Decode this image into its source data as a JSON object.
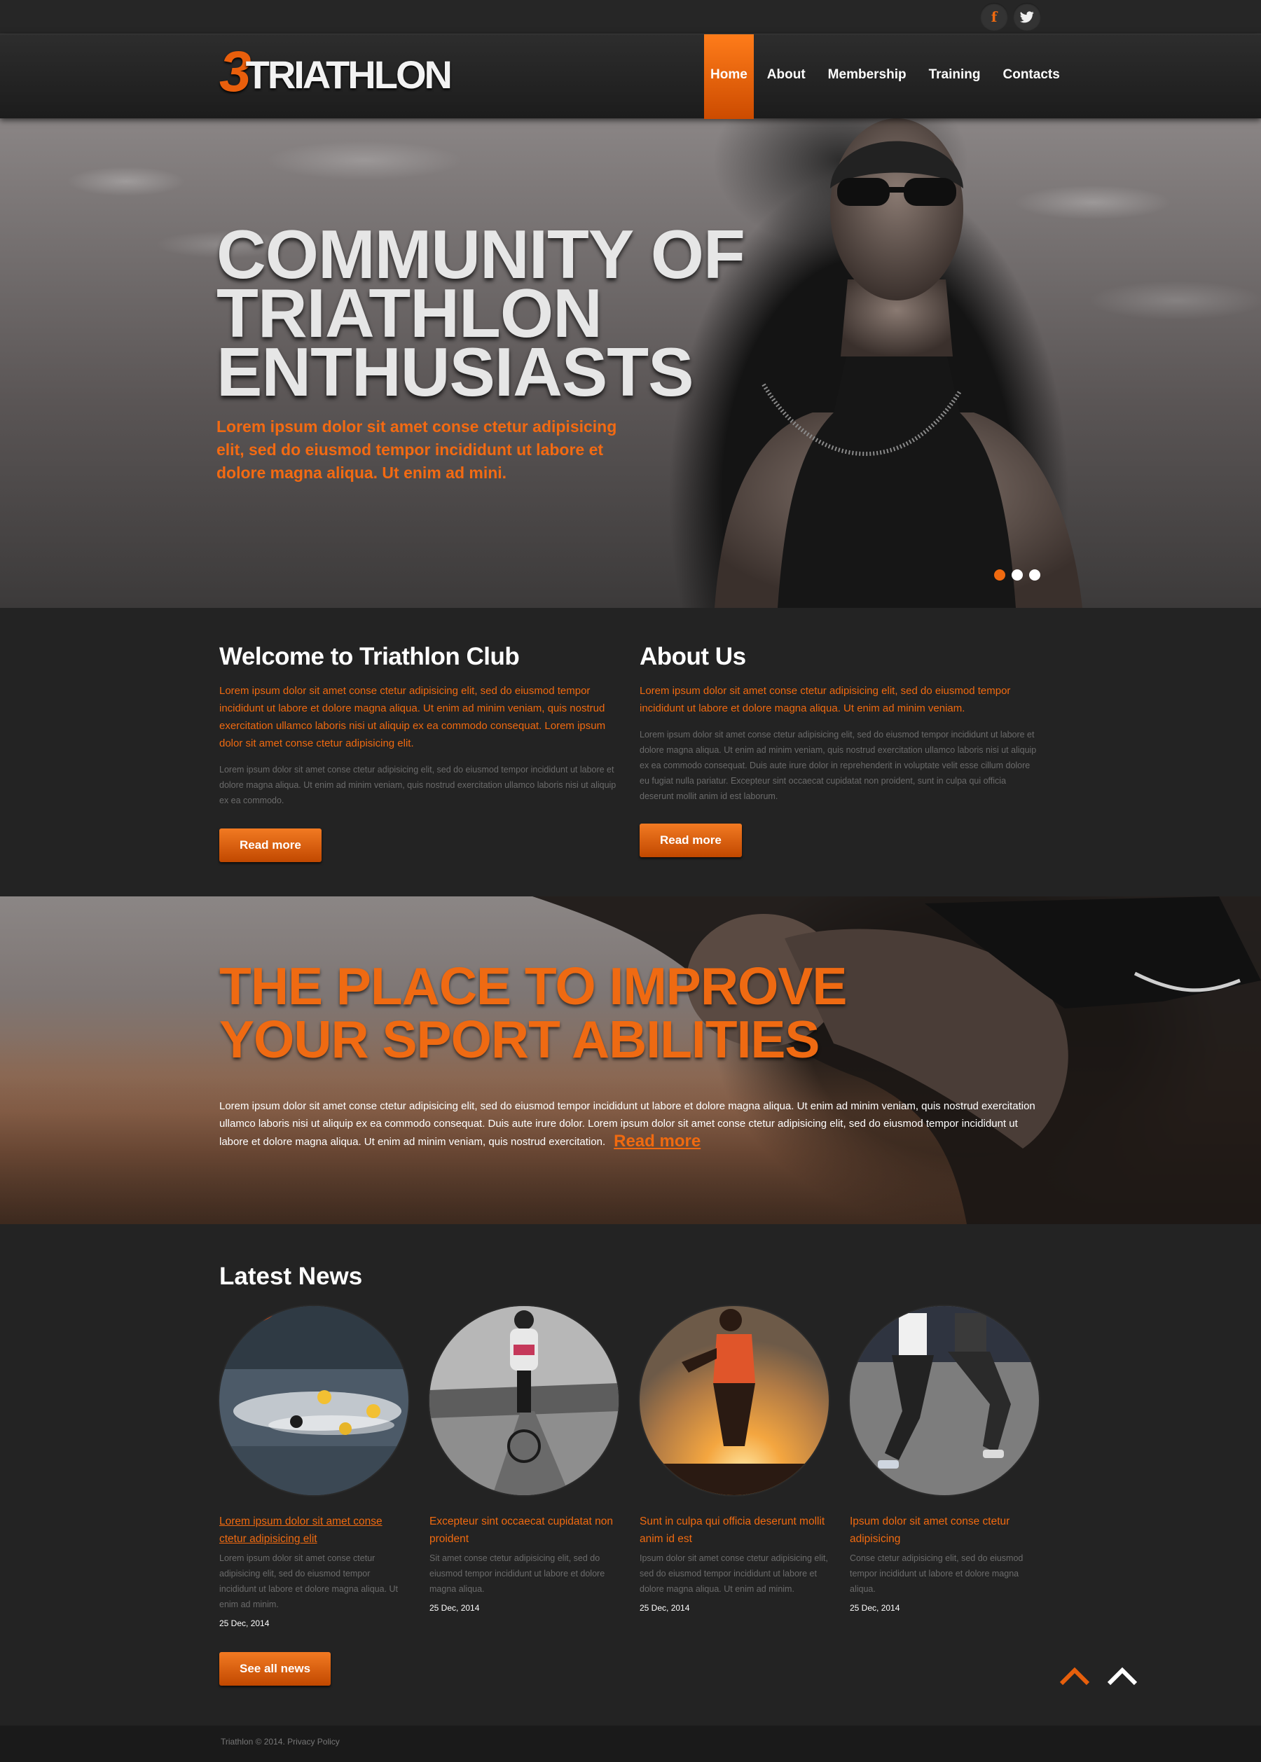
{
  "social": {
    "facebook_glyph": "f",
    "twitter_glyph": "🐦"
  },
  "logo": {
    "number": "3",
    "text": "TRIATHLON"
  },
  "nav": [
    {
      "label": "Home",
      "active": true
    },
    {
      "label": "About",
      "active": false
    },
    {
      "label": "Membership",
      "active": false
    },
    {
      "label": "Training",
      "active": false
    },
    {
      "label": "Contacts",
      "active": false
    }
  ],
  "hero": {
    "title": "COMMUNITY OF\nTRIATHLON\nENTHUSIASTS",
    "subtitle": "Lorem ipsum dolor sit amet conse ctetur adipisicing elit, sed do eiusmod tempor incididunt ut labore et dolore magna aliqua. Ut enim ad mini.",
    "slides": 3,
    "active_slide": 1
  },
  "welcome": {
    "title": "Welcome to Triathlon Club",
    "lead": "Lorem ipsum dolor sit amet conse ctetur adipisicing elit, sed do eiusmod tempor incididunt ut labore et dolore magna aliqua. Ut enim ad minim veniam, quis nostrud exercitation ullamco laboris nisi ut aliquip ex ea commodo consequat. Lorem ipsum dolor sit amet conse ctetur adipisicing elit.",
    "body": "Lorem ipsum dolor sit amet conse ctetur adipisicing elit, sed do eiusmod tempor incididunt ut labore et dolore magna aliqua. Ut enim ad minim veniam, quis nostrud exercitation ullamco laboris nisi ut aliquip ex ea commodo.",
    "button": "Read more"
  },
  "about": {
    "title": "About Us",
    "lead": "Lorem ipsum dolor sit amet conse ctetur adipisicing elit, sed do eiusmod tempor incididunt ut labore et dolore magna aliqua. Ut enim ad minim veniam.",
    "body": "Lorem ipsum dolor sit amet conse ctetur adipisicing elit, sed do eiusmod tempor incididunt ut labore et dolore magna aliqua. Ut enim ad minim veniam, quis nostrud exercitation ullamco laboris nisi ut aliquip ex ea commodo consequat. Duis aute irure dolor in reprehenderit in voluptate velit esse cillum dolore eu fugiat nulla pariatur. Excepteur sint occaecat cupidatat non proident, sunt in culpa qui officia deserunt mollit anim id est laborum.",
    "button": "Read more"
  },
  "improve": {
    "title": "THE PLACE TO IMPROVE\nYOUR SPORT ABILITIES",
    "body": "Lorem ipsum dolor sit amet conse ctetur adipisicing elit, sed do eiusmod tempor incididunt ut labore et dolore magna aliqua. Ut enim ad minim veniam, quis nostrud exercita­tion ullamco laboris nisi ut aliquip ex ea commodo consequat. Duis aute irure dolor. Lorem ipsum dolor sit amet conse ctetur adipisicing elit, sed do eiusmod tempor incidi­dunt ut labore et dolore magna aliqua. Ut enim ad minim veniam, quis nostrud exercitation.",
    "link": "Read more"
  },
  "news": {
    "title": "Latest News",
    "items": [
      {
        "headline": "Lorem ipsum dolor sit amet conse ctetur adipisicing elit",
        "body": "Lorem ipsum dolor sit amet conse ctetur adipisicing elit, sed do eiusmod tempor incididunt ut labore et dolore magna aliqua. Ut enim ad minim.",
        "date": "25 Dec, 2014"
      },
      {
        "headline": "Excepteur sint occaecat cupidatat non proident",
        "body": "Sit amet conse ctetur adipisicing elit, sed do eiusmod tempor incididunt ut labore et dolore magna aliqua.",
        "date": "25 Dec, 2014"
      },
      {
        "headline": "Sunt in culpa qui officia deserunt mollit anim id est",
        "body": "Ipsum dolor sit amet conse ctetur adipisic­ing elit, sed do eiusmod tempor incididunt ut labore et dolore magna aliqua. Ut enim ad minim.",
        "date": "25 Dec, 2014"
      },
      {
        "headline": "Ipsum dolor sit amet conse ctetur adipisicing",
        "body": "Conse ctetur adipisicing elit, sed do eius­mod tempor incididunt ut labore et dolore magna aliqua.",
        "date": "25 Dec, 2014"
      }
    ],
    "button": "See all news"
  },
  "footer": {
    "copyright": "Triathlon © 2014.",
    "privacy": "Privacy Policy"
  },
  "colors": {
    "accent": "#f06a10",
    "background": "#232323",
    "muted_text": "#6b6b6b"
  }
}
